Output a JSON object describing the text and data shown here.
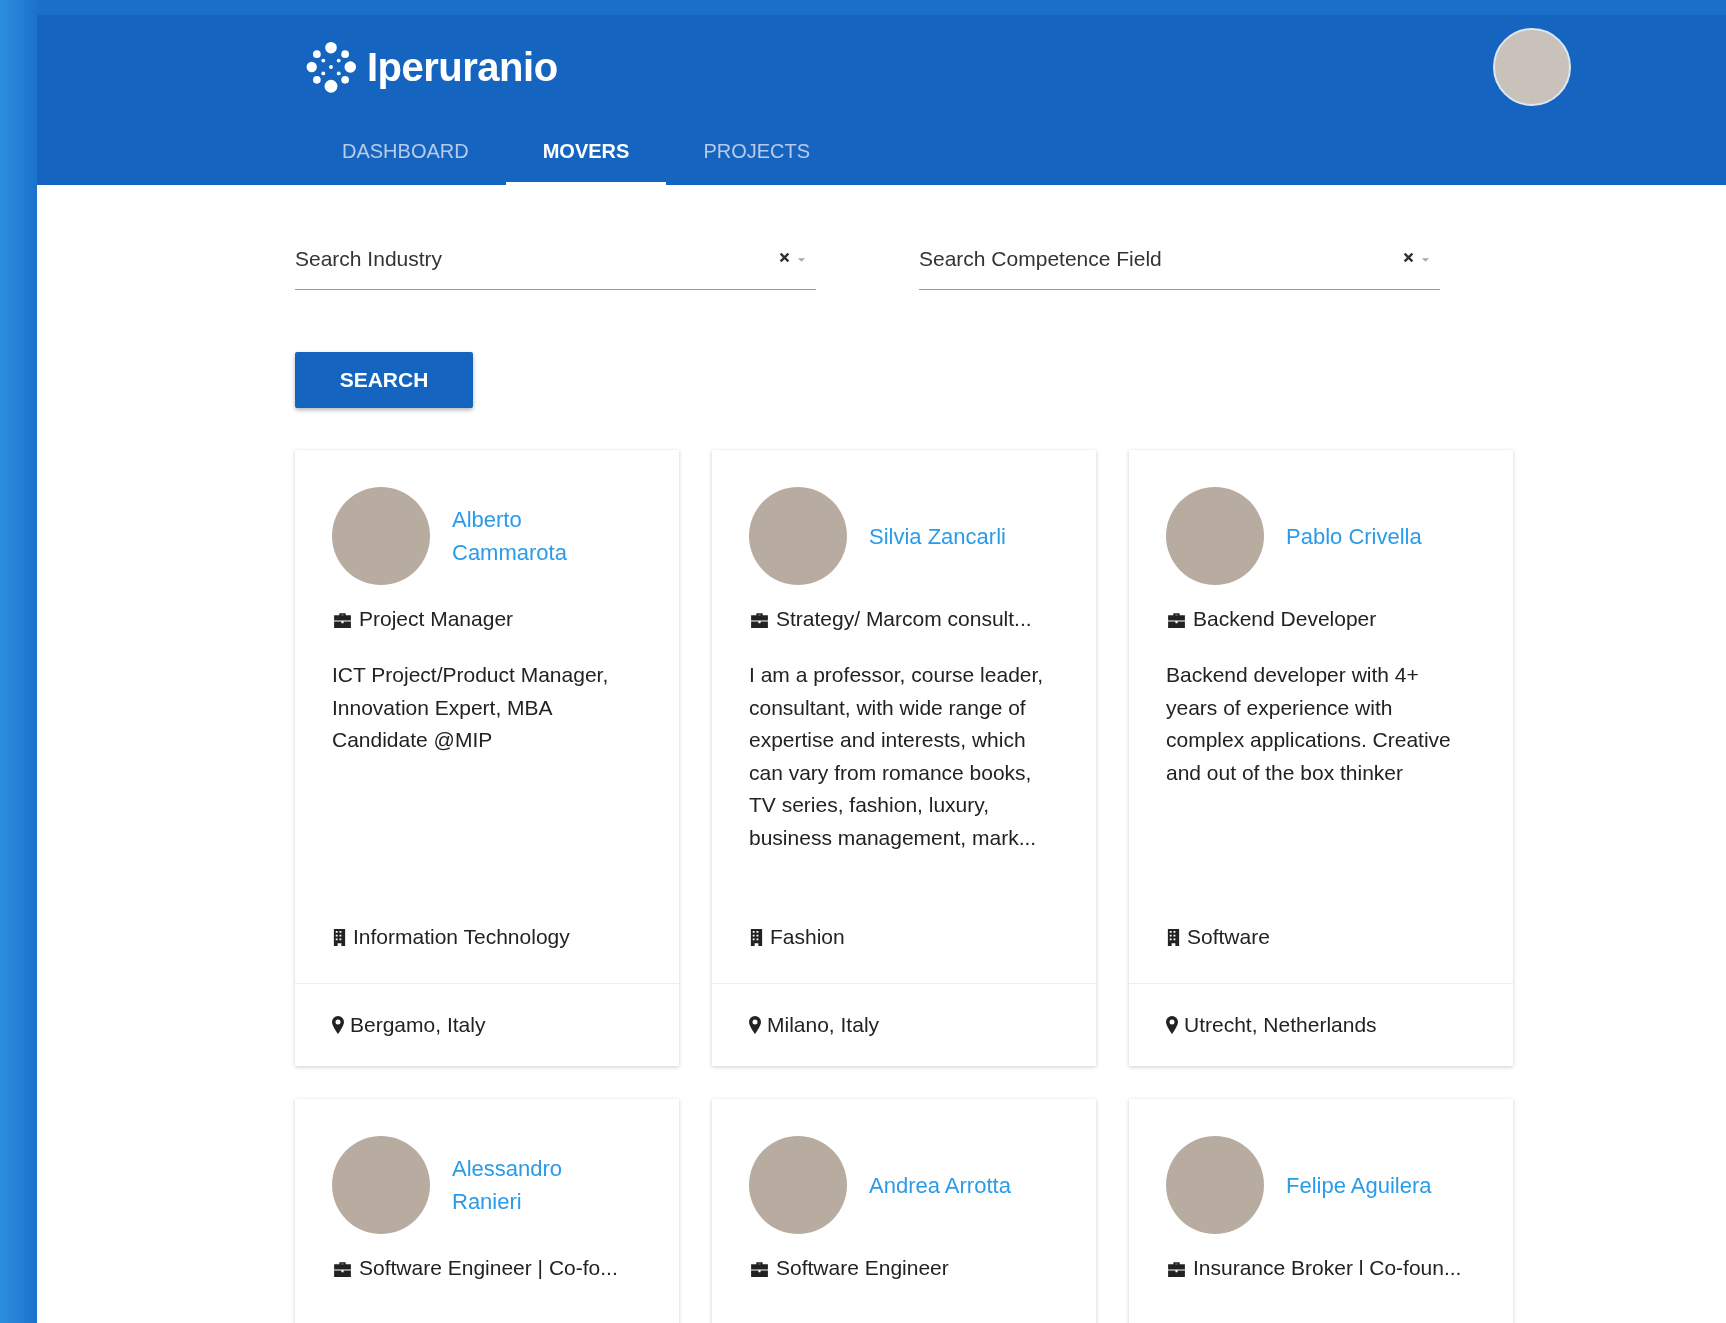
{
  "app": {
    "name": "Iperuranio"
  },
  "tabs": [
    {
      "label": "DASHBOARD",
      "selected": false
    },
    {
      "label": "MOVERS",
      "selected": true
    },
    {
      "label": "PROJECTS",
      "selected": false
    }
  ],
  "filters": [
    {
      "placeholder": "Search Industry"
    },
    {
      "placeholder": "Search Competence Field"
    }
  ],
  "search_button": "SEARCH",
  "movers": [
    {
      "name": "Alberto Cammarota",
      "role": "Project Manager",
      "bio": "ICT Project/Product Manager, Innovation Expert, MBA Candidate @MIP",
      "industry": "Information Technology",
      "location": "Bergamo, Italy"
    },
    {
      "name": "Silvia Zancarli",
      "role": "Strategy/ Marcom consult...",
      "bio": "I am a professor, course leader, consultant, with wide range of expertise and interests, which can vary from romance books, TV series, fashion, luxury, business management, mark...",
      "industry": "Fashion",
      "location": "Milano, Italy"
    },
    {
      "name": "Pablo Crivella",
      "role": "Backend Developer",
      "bio": "Backend developer with 4+ years of experience with complex applications. Creative and out of the box thinker",
      "industry": "Software",
      "location": "Utrecht, Netherlands"
    },
    {
      "name": "Alessandro Ranieri",
      "role": "Software Engineer | Co-fo..."
    },
    {
      "name": "Andrea Arrotta",
      "role": "Software Engineer"
    },
    {
      "name": "Felipe Aguilera",
      "role": "Insurance Broker l Co-foun..."
    }
  ]
}
